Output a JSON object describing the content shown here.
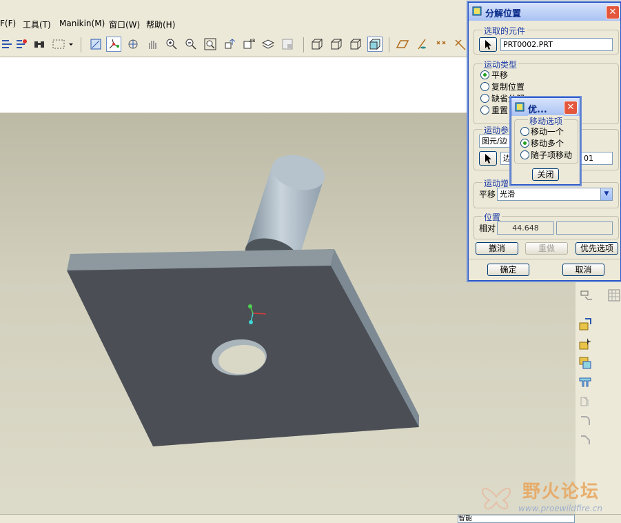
{
  "menubar": {
    "items": [
      "F(F)",
      "工具(T)",
      "Manikin(M)",
      "窗口(W)",
      "帮助(H)"
    ]
  },
  "dialog": {
    "title": "分解位置",
    "close_symbol": "✕",
    "selected_component": {
      "group_label": "选取的元件",
      "value": "PRT0002.PRT"
    },
    "motion_type": {
      "group_label": "运动类型",
      "options": [
        "平移",
        "复制位置",
        "缺省分解",
        "重置"
      ],
      "selected": "平移"
    },
    "motion_reference": {
      "group_label": "运动参",
      "dropdown_value": "图元/边",
      "field_prefix": "边",
      "field_suffix": "01"
    },
    "motion_increment": {
      "group_label": "运动增",
      "label": "平移",
      "value": "光滑"
    },
    "position": {
      "group_label": "位置",
      "label": "相对",
      "value": "44.648",
      "extra": ""
    },
    "buttons": {
      "undo": "撤消",
      "redo": "重做",
      "preferences": "优先选项",
      "ok": "确定",
      "cancel": "取消"
    }
  },
  "popup": {
    "title": "优...",
    "group_label": "移动选项",
    "options": [
      "移动一个",
      "移动多个",
      "随子项移动"
    ],
    "selected": "移动多个",
    "close_button": "关闭"
  },
  "watermark": {
    "title": "野火论坛",
    "url": "www.proewildfire.cn"
  },
  "statusbar": {
    "text": "智能"
  },
  "colors": {
    "dialog_title_text": "#0a2a8a",
    "group_label": "#1a3aa8",
    "plate_face": "#4b4f55",
    "plate_top_edge": "#8d989f",
    "plate_side": "#7d8a94",
    "cylinder": "#a7b7c3",
    "watermark": "#e8a55c"
  }
}
